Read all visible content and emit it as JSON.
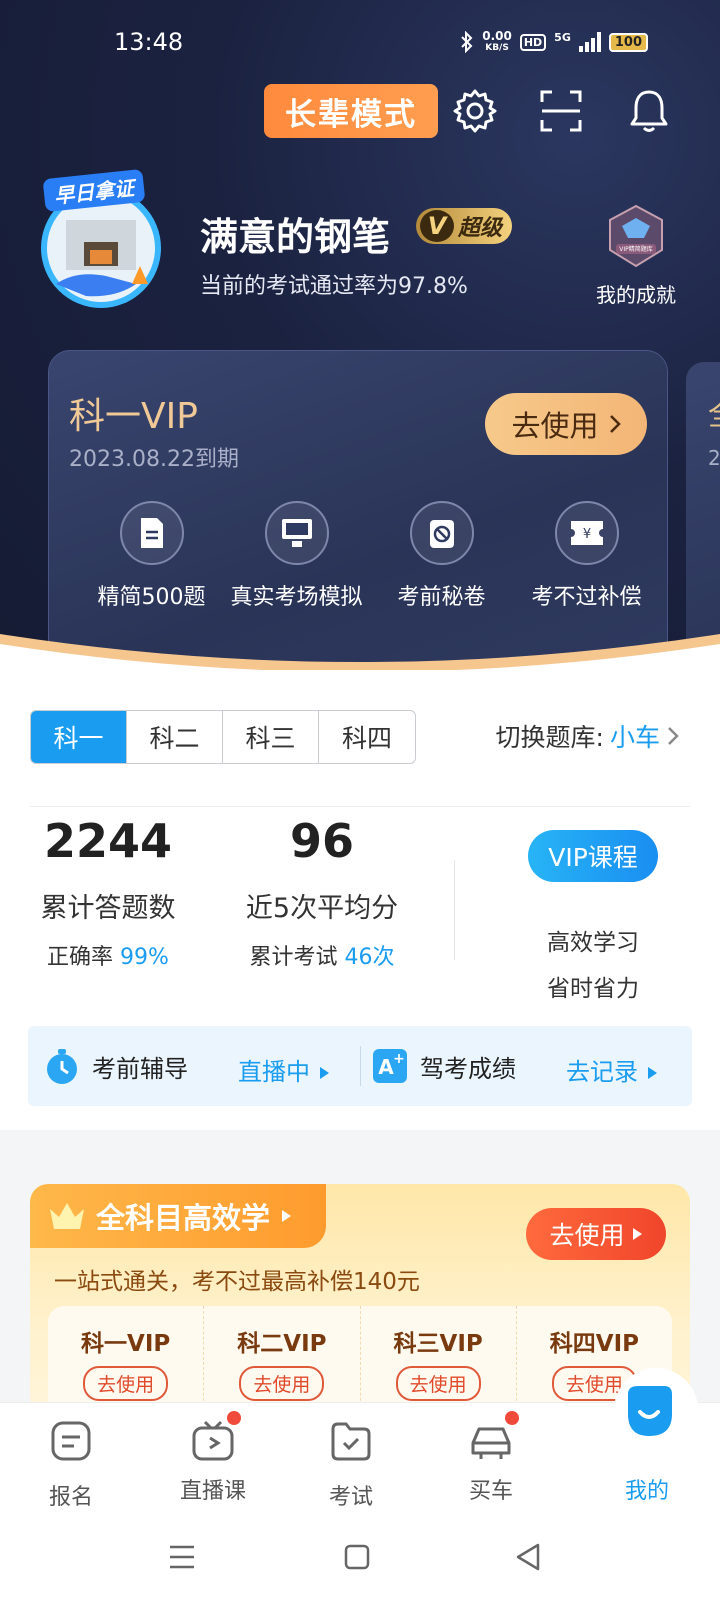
{
  "status_bar": {
    "time": "13:48",
    "net_speed_value": "0.00",
    "net_speed_unit": "KB/S",
    "hd": "HD",
    "network": "5G",
    "battery": "100"
  },
  "header": {
    "elder_mode_label": "长辈模式",
    "avatar_badge": "早日拿证",
    "username": "满意的钢笔",
    "vip_level": "超级",
    "vip_mark": "V",
    "pass_rate": "当前的考试通过率为97.8%",
    "achievement_label": "我的成就",
    "medal_text": "VIP精简题库"
  },
  "vip_card": {
    "title": "科一VIP",
    "expire": "2023.08.22到期",
    "use_label": "去使用",
    "features": [
      {
        "icon": "document-icon",
        "label": "精简500题"
      },
      {
        "icon": "monitor-icon",
        "label": "真实考场模拟"
      },
      {
        "icon": "secret-scroll-icon",
        "label": "考前秘卷"
      },
      {
        "icon": "compensation-ticket-icon",
        "label": "考不过补偿"
      }
    ],
    "next_card_title": "全",
    "next_card_sub": "2"
  },
  "subjects": {
    "tabs": [
      "科一",
      "科二",
      "科三",
      "科四"
    ],
    "active": "科一",
    "switch_label": "切换题库:",
    "switch_value": "小车"
  },
  "stats": {
    "total_answers": "2244",
    "total_answers_label": "累计答题数",
    "accuracy_label": "正确率",
    "accuracy_value": "99%",
    "avg_score": "96",
    "avg_score_label": "近5次平均分",
    "exam_count_label": "累计考试",
    "exam_count_value": "46次",
    "vip_course_label": "VIP课程",
    "course_line1": "高效学习",
    "course_line2": "省时省力"
  },
  "info_bar": {
    "guide_label": "考前辅导",
    "guide_link": "直播中",
    "score_label": "驾考成绩",
    "score_link": "去记录"
  },
  "promo": {
    "title": "全科目高效学",
    "use_label": "去使用",
    "subtitle": "一站式通关，考不过最高补偿140元",
    "items": [
      {
        "title": "科一VIP",
        "button": "去使用"
      },
      {
        "title": "科二VIP",
        "button": "去使用"
      },
      {
        "title": "科三VIP",
        "button": "去使用"
      },
      {
        "title": "科四VIP",
        "button": "去使用"
      }
    ]
  },
  "bottom_nav": {
    "items": [
      {
        "label": "报名",
        "icon": "register-icon"
      },
      {
        "label": "直播课",
        "icon": "live-tv-icon"
      },
      {
        "label": "考试",
        "icon": "exam-folder-icon"
      },
      {
        "label": "买车",
        "icon": "car-icon"
      },
      {
        "label": "我的",
        "icon": "profile-icon"
      }
    ],
    "active": "我的"
  },
  "colors": {
    "accent": "#1a9cf0",
    "header_bg": "#1b2240",
    "elder_orange": "#ff8a3d",
    "vip_gold": "#f0c996",
    "badge_red": "#f04a3a"
  }
}
